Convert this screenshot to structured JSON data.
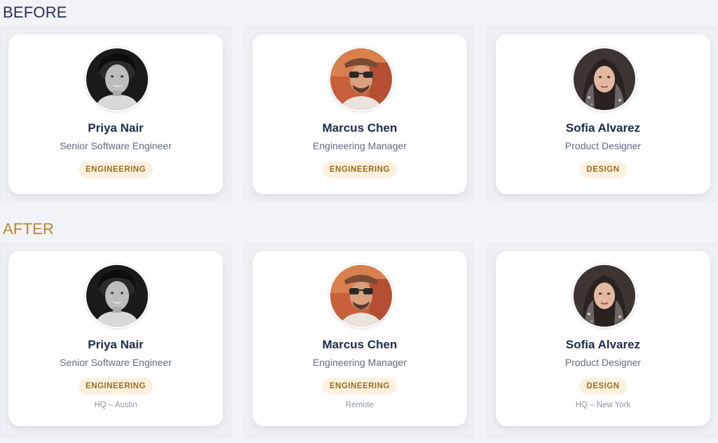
{
  "sections": {
    "before": {
      "label": "BEFORE"
    },
    "after": {
      "label": "AFTER"
    }
  },
  "colors": {
    "before_label": "#24305a",
    "after_label": "#b7862c",
    "badge_bg": "#fcf1df",
    "badge_text": "#9a6f1f",
    "name_text": "#1e2a4a"
  },
  "before": {
    "cards": [
      {
        "name": "Priya Nair",
        "title": "Senior Software Engineer",
        "department": "ENGINEERING",
        "avatar_icon": "avatar-photo-icon"
      },
      {
        "name": "Marcus Chen",
        "title": "Engineering Manager",
        "department": "ENGINEERING",
        "avatar_icon": "avatar-photo-icon"
      },
      {
        "name": "Sofia Alvarez",
        "title": "Product Designer",
        "department": "DESIGN",
        "avatar_icon": "avatar-photo-icon"
      }
    ]
  },
  "after": {
    "cards": [
      {
        "name": "Priya Nair",
        "title": "Senior Software Engineer",
        "department": "ENGINEERING",
        "location": "HQ – Austin",
        "avatar_icon": "avatar-photo-icon"
      },
      {
        "name": "Marcus Chen",
        "title": "Engineering Manager",
        "department": "ENGINEERING",
        "location": "Remote",
        "avatar_icon": "avatar-photo-icon"
      },
      {
        "name": "Sofia Alvarez",
        "title": "Product Designer",
        "department": "DESIGN",
        "location": "HQ – New York",
        "avatar_icon": "avatar-photo-icon"
      }
    ]
  }
}
